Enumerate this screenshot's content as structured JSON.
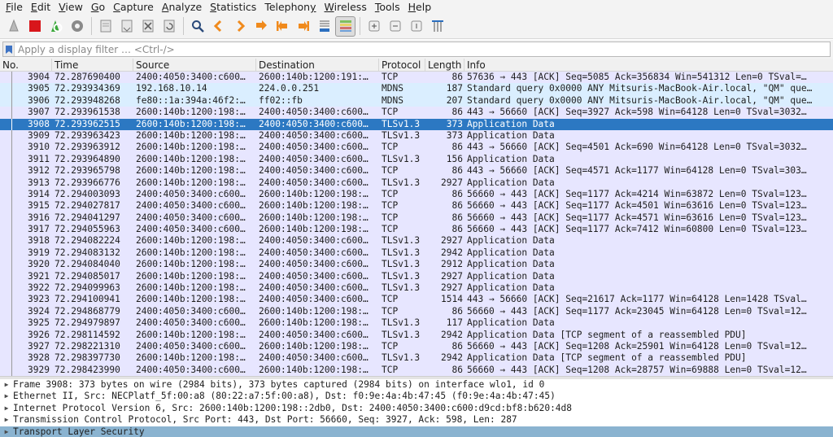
{
  "menu": [
    {
      "u": "F",
      "rest": "ile"
    },
    {
      "u": "E",
      "rest": "dit"
    },
    {
      "u": "V",
      "rest": "iew"
    },
    {
      "u": "G",
      "rest": "o"
    },
    {
      "u": "C",
      "rest": "apture"
    },
    {
      "u": "A",
      "rest": "nalyze"
    },
    {
      "u": "S",
      "rest": "tatistics"
    },
    {
      "u": "",
      "rest": "Telephon",
      "u2": "y"
    },
    {
      "u": "W",
      "rest": "ireless"
    },
    {
      "u": "T",
      "rest": "ools"
    },
    {
      "u": "H",
      "rest": "elp"
    }
  ],
  "filter": {
    "placeholder": "Apply a display filter … <Ctrl-/>",
    "value": ""
  },
  "columns": [
    "No.",
    "Time",
    "Source",
    "Destination",
    "Protocol",
    "Length",
    "Info"
  ],
  "colors": {
    "tcp": "#e7e6ff",
    "udp": "#daeeff",
    "selected": "#2c78c2"
  },
  "packets": [
    {
      "no": "3904",
      "time": "72.287690400",
      "src": "2400:4050:3400:c600…",
      "dst": "2600:140b:1200:191:…",
      "proto": "TCP",
      "len": "86",
      "info": "57636 → 443 [ACK] Seq=5085 Ack=356834 Win=541312 Len=0 TSval=…",
      "kind": "tcp"
    },
    {
      "no": "3905",
      "time": "72.293934369",
      "src": "192.168.10.14",
      "dst": "224.0.0.251",
      "proto": "MDNS",
      "len": "187",
      "info": "Standard query 0x0000 ANY Mitsuris-MacBook-Air.local, \"QM\" que…",
      "kind": "udp"
    },
    {
      "no": "3906",
      "time": "72.293948268",
      "src": "fe80::1a:394a:46f2:…",
      "dst": "ff02::fb",
      "proto": "MDNS",
      "len": "207",
      "info": "Standard query 0x0000 ANY Mitsuris-MacBook-Air.local, \"QM\" que…",
      "kind": "udp"
    },
    {
      "no": "3907",
      "time": "72.293961538",
      "src": "2600:140b:1200:198:…",
      "dst": "2400:4050:3400:c600…",
      "proto": "TCP",
      "len": "86",
      "info": "443 → 56660 [ACK] Seq=3927 Ack=598 Win=64128 Len=0 TSval=3032…",
      "kind": "tcp"
    },
    {
      "no": "3908",
      "time": "72.293962515",
      "src": "2600:140b:1200:198:…",
      "dst": "2400:4050:3400:c600…",
      "proto": "TLSv1.3",
      "len": "373",
      "info": "Application Data",
      "kind": "selected"
    },
    {
      "no": "3909",
      "time": "72.293963423",
      "src": "2600:140b:1200:198:…",
      "dst": "2400:4050:3400:c600…",
      "proto": "TLSv1.3",
      "len": "373",
      "info": "Application Data",
      "kind": "tcp"
    },
    {
      "no": "3910",
      "time": "72.293963912",
      "src": "2600:140b:1200:198:…",
      "dst": "2400:4050:3400:c600…",
      "proto": "TCP",
      "len": "86",
      "info": "443 → 56660 [ACK] Seq=4501 Ack=690 Win=64128 Len=0 TSval=3032…",
      "kind": "tcp"
    },
    {
      "no": "3911",
      "time": "72.293964890",
      "src": "2600:140b:1200:198:…",
      "dst": "2400:4050:3400:c600…",
      "proto": "TLSv1.3",
      "len": "156",
      "info": "Application Data",
      "kind": "tcp"
    },
    {
      "no": "3912",
      "time": "72.293965798",
      "src": "2600:140b:1200:198:…",
      "dst": "2400:4050:3400:c600…",
      "proto": "TCP",
      "len": "86",
      "info": "443 → 56660 [ACK] Seq=4571 Ack=1177 Win=64128 Len=0 TSval=303…",
      "kind": "tcp"
    },
    {
      "no": "3913",
      "time": "72.293966776",
      "src": "2600:140b:1200:198:…",
      "dst": "2400:4050:3400:c600…",
      "proto": "TLSv1.3",
      "len": "2927",
      "info": "Application Data",
      "kind": "tcp"
    },
    {
      "no": "3914",
      "time": "72.294003093",
      "src": "2400:4050:3400:c600…",
      "dst": "2600:140b:1200:198:…",
      "proto": "TCP",
      "len": "86",
      "info": "56660 → 443 [ACK] Seq=1177 Ack=4214 Win=63872 Len=0 TSval=123…",
      "kind": "tcp"
    },
    {
      "no": "3915",
      "time": "72.294027817",
      "src": "2400:4050:3400:c600…",
      "dst": "2600:140b:1200:198:…",
      "proto": "TCP",
      "len": "86",
      "info": "56660 → 443 [ACK] Seq=1177 Ack=4501 Win=63616 Len=0 TSval=123…",
      "kind": "tcp"
    },
    {
      "no": "3916",
      "time": "72.294041297",
      "src": "2400:4050:3400:c600…",
      "dst": "2600:140b:1200:198:…",
      "proto": "TCP",
      "len": "86",
      "info": "56660 → 443 [ACK] Seq=1177 Ack=4571 Win=63616 Len=0 TSval=123…",
      "kind": "tcp"
    },
    {
      "no": "3917",
      "time": "72.294055963",
      "src": "2400:4050:3400:c600…",
      "dst": "2600:140b:1200:198:…",
      "proto": "TCP",
      "len": "86",
      "info": "56660 → 443 [ACK] Seq=1177 Ack=7412 Win=60800 Len=0 TSval=123…",
      "kind": "tcp"
    },
    {
      "no": "3918",
      "time": "72.294082224",
      "src": "2600:140b:1200:198:…",
      "dst": "2400:4050:3400:c600…",
      "proto": "TLSv1.3",
      "len": "2927",
      "info": "Application Data",
      "kind": "tcp"
    },
    {
      "no": "3919",
      "time": "72.294083132",
      "src": "2600:140b:1200:198:…",
      "dst": "2400:4050:3400:c600…",
      "proto": "TLSv1.3",
      "len": "2942",
      "info": "Application Data",
      "kind": "tcp"
    },
    {
      "no": "3920",
      "time": "72.294084040",
      "src": "2600:140b:1200:198:…",
      "dst": "2400:4050:3400:c600…",
      "proto": "TLSv1.3",
      "len": "2912",
      "info": "Application Data",
      "kind": "tcp"
    },
    {
      "no": "3921",
      "time": "72.294085017",
      "src": "2600:140b:1200:198:…",
      "dst": "2400:4050:3400:c600…",
      "proto": "TLSv1.3",
      "len": "2927",
      "info": "Application Data",
      "kind": "tcp"
    },
    {
      "no": "3922",
      "time": "72.294099963",
      "src": "2600:140b:1200:198:…",
      "dst": "2400:4050:3400:c600…",
      "proto": "TLSv1.3",
      "len": "2927",
      "info": "Application Data",
      "kind": "tcp"
    },
    {
      "no": "3923",
      "time": "72.294100941",
      "src": "2600:140b:1200:198:…",
      "dst": "2400:4050:3400:c600…",
      "proto": "TCP",
      "len": "1514",
      "info": "443 → 56660 [ACK] Seq=21617 Ack=1177 Win=64128 Len=1428 TSval…",
      "kind": "tcp"
    },
    {
      "no": "3924",
      "time": "72.294868779",
      "src": "2400:4050:3400:c600…",
      "dst": "2600:140b:1200:198:…",
      "proto": "TCP",
      "len": "86",
      "info": "56660 → 443 [ACK] Seq=1177 Ack=23045 Win=64128 Len=0 TSval=12…",
      "kind": "tcp"
    },
    {
      "no": "3925",
      "time": "72.294979897",
      "src": "2400:4050:3400:c600…",
      "dst": "2600:140b:1200:198:…",
      "proto": "TLSv1.3",
      "len": "117",
      "info": "Application Data",
      "kind": "tcp"
    },
    {
      "no": "3926",
      "time": "72.298114592",
      "src": "2600:140b:1200:198:…",
      "dst": "2400:4050:3400:c600…",
      "proto": "TLSv1.3",
      "len": "2942",
      "info": "Application Data [TCP segment of a reassembled PDU]",
      "kind": "tcp"
    },
    {
      "no": "3927",
      "time": "72.298221310",
      "src": "2400:4050:3400:c600…",
      "dst": "2600:140b:1200:198:…",
      "proto": "TCP",
      "len": "86",
      "info": "56660 → 443 [ACK] Seq=1208 Ack=25901 Win=64128 Len=0 TSval=12…",
      "kind": "tcp"
    },
    {
      "no": "3928",
      "time": "72.298397730",
      "src": "2600:140b:1200:198:…",
      "dst": "2400:4050:3400:c600…",
      "proto": "TLSv1.3",
      "len": "2942",
      "info": "Application Data [TCP segment of a reassembled PDU]",
      "kind": "tcp"
    },
    {
      "no": "3929",
      "time": "72.298423990",
      "src": "2400:4050:3400:c600…",
      "dst": "2600:140b:1200:198:…",
      "proto": "TCP",
      "len": "86",
      "info": "56660 → 443 [ACK] Seq=1208 Ack=28757 Win=69888 Len=0 TSval=12…",
      "kind": "tcp"
    }
  ],
  "details": [
    {
      "text": "Frame 3908: 373 bytes on wire (2984 bits), 373 bytes captured (2984 bits) on interface wlo1, id 0",
      "selected": false
    },
    {
      "text": "Ethernet II, Src: NECPlatf_5f:00:a8 (80:22:a7:5f:00:a8), Dst: f0:9e:4a:4b:47:45 (f0:9e:4a:4b:47:45)",
      "selected": false
    },
    {
      "text": "Internet Protocol Version 6, Src: 2600:140b:1200:198::2db0, Dst: 2400:4050:3400:c600:d9cd:bf8:b620:4d8",
      "selected": false
    },
    {
      "text": "Transmission Control Protocol, Src Port: 443, Dst Port: 56660, Seq: 3927, Ack: 598, Len: 287",
      "selected": false
    },
    {
      "text": "Transport Layer Security",
      "selected": true
    }
  ]
}
